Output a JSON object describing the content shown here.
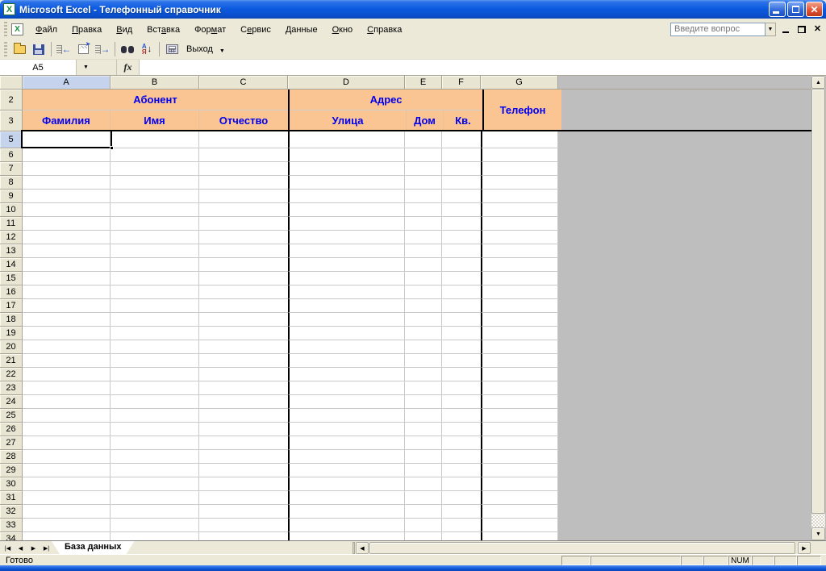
{
  "window": {
    "title": "Microsoft Excel - Телефонный справочник"
  },
  "menu": {
    "items": [
      {
        "pre": "",
        "key": "Ф",
        "post": "айл"
      },
      {
        "pre": "",
        "key": "П",
        "post": "равка"
      },
      {
        "pre": "",
        "key": "В",
        "post": "ид"
      },
      {
        "pre": "Вст",
        "key": "а",
        "post": "вка"
      },
      {
        "pre": "Фор",
        "key": "м",
        "post": "ат"
      },
      {
        "pre": "С",
        "key": "е",
        "post": "рвис"
      },
      {
        "pre": "",
        "key": "Д",
        "post": "анные"
      },
      {
        "pre": "",
        "key": "О",
        "post": "кно"
      },
      {
        "pre": "",
        "key": "С",
        "post": "правка"
      }
    ],
    "question_placeholder": "Введите вопрос"
  },
  "toolbar": {
    "exit_label": "Выход"
  },
  "formula_bar": {
    "name_box": "A5",
    "fx_label": "fx"
  },
  "grid": {
    "columns": [
      "A",
      "B",
      "C",
      "D",
      "E",
      "F",
      "G"
    ],
    "active_column": "A",
    "active_row": 5,
    "header_rows": [
      2,
      3
    ],
    "body_rows": [
      5,
      6,
      7,
      8,
      9,
      10,
      11,
      12,
      13,
      14,
      15,
      16,
      17,
      18,
      19,
      20,
      21,
      22,
      23,
      24,
      25,
      26,
      27,
      28,
      29,
      30,
      31,
      32,
      33,
      34
    ],
    "headers": {
      "abonent": "Абонент",
      "adres": "Адрес",
      "telefon": "Телефон",
      "familiya": "Фамилия",
      "imya": "Имя",
      "otchestvo": "Отчество",
      "ulitsa": "Улица",
      "dom": "Дом",
      "kv": "Кв."
    }
  },
  "sheet_tabs": {
    "active": "База данных"
  },
  "status_bar": {
    "ready": "Готово",
    "num": "NUM"
  },
  "colors": {
    "header_fill": "#FAC493",
    "header_text": "#0000EE",
    "title_blue": "#0D5BE0",
    "outside_gray": "#BEBEBE",
    "close_red": "#E25537"
  }
}
